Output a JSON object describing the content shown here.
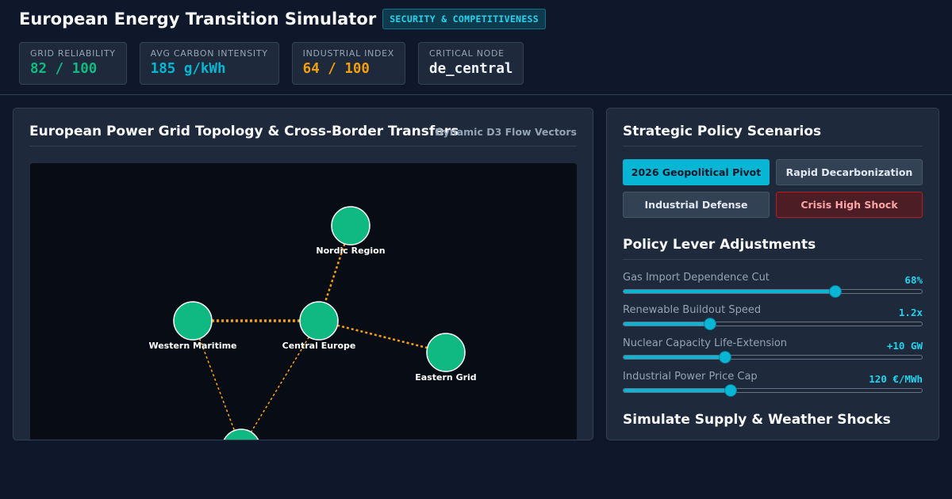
{
  "app": {
    "title": "European Energy Transition Simulator",
    "badge": "SECURITY & COMPETITIVENESS"
  },
  "metrics": [
    {
      "label": "GRID RELIABILITY",
      "value": "82 / 100",
      "color": "#10b981"
    },
    {
      "label": "AVG CARBON INTENSITY",
      "value": "185 g/kWh",
      "color": "#06b6d4"
    },
    {
      "label": "INDUSTRIAL INDEX",
      "value": "64 / 100",
      "color": "#f59e0b"
    },
    {
      "label": "CRITICAL NODE",
      "value": "de_central",
      "color": "#f1f5f9"
    }
  ],
  "grid_panel": {
    "title": "European Power Grid Topology & Cross-Border Transfers",
    "subtitle": "Dynamic D3 Flow Vectors",
    "node_color": "#10b981",
    "flow_color": "#f59e0b",
    "nodes": [
      {
        "id": "nordic",
        "label": "Nordic Region"
      },
      {
        "id": "western",
        "label": "Western Maritime"
      },
      {
        "id": "central",
        "label": "Central Europe"
      },
      {
        "id": "eastern",
        "label": "Eastern Grid"
      },
      {
        "id": "southern",
        "label": ""
      }
    ],
    "links": [
      {
        "from": "nordic",
        "to": "central",
        "weight": "medium"
      },
      {
        "from": "western",
        "to": "central",
        "weight": "heavy"
      },
      {
        "from": "central",
        "to": "eastern",
        "weight": "medium"
      },
      {
        "from": "western",
        "to": "southern",
        "weight": "light"
      },
      {
        "from": "central",
        "to": "southern",
        "weight": "light"
      }
    ]
  },
  "policy": {
    "scenarios_title": "Strategic Policy Scenarios",
    "scenarios": [
      {
        "label": "2026 Geopolitical Pivot",
        "state": "active"
      },
      {
        "label": "Rapid Decarbonization",
        "state": "normal"
      },
      {
        "label": "Industrial Defense",
        "state": "normal"
      },
      {
        "label": "Crisis High Shock",
        "state": "crisis"
      }
    ],
    "levers_title": "Policy Lever Adjustments",
    "levers": [
      {
        "label": "Gas Import Dependence Cut",
        "value": "68%",
        "level": 0.71
      },
      {
        "label": "Renewable Buildout Speed",
        "value": "1.2x",
        "level": 0.29
      },
      {
        "label": "Nuclear Capacity Life-Extension",
        "value": "+10 GW",
        "level": 0.34
      },
      {
        "label": "Industrial Power Price Cap",
        "value": "120 €/MWh",
        "level": 0.36
      }
    ],
    "shocks_title": "Simulate Supply & Weather Shocks"
  }
}
